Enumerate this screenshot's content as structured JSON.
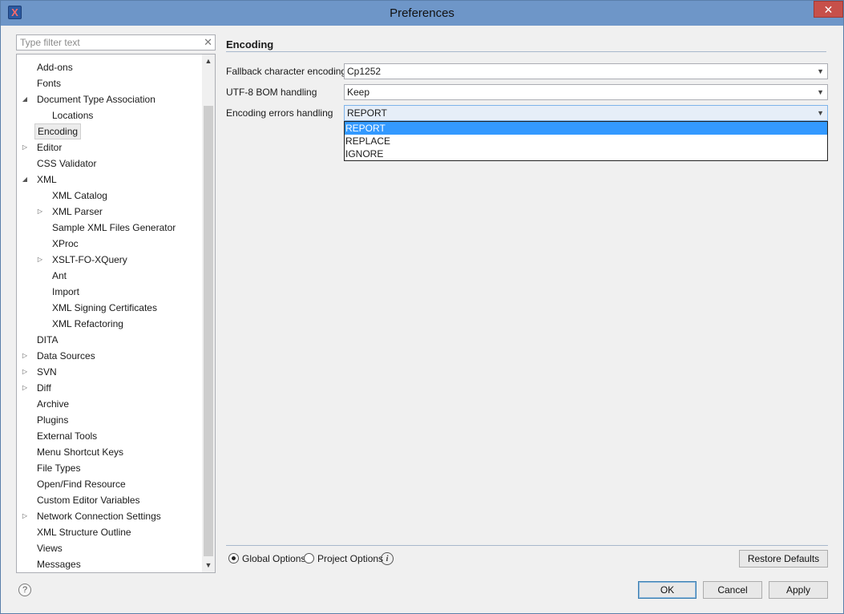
{
  "window": {
    "title": "Preferences",
    "close_glyph": "✕",
    "app_icon_glyph": "X"
  },
  "filter": {
    "placeholder": "Type filter text",
    "clear_glyph": "✕"
  },
  "tree": {
    "items": [
      {
        "label": "Add-ons",
        "level": 1,
        "arrow": ""
      },
      {
        "label": "Fonts",
        "level": 1,
        "arrow": ""
      },
      {
        "label": "Document Type Association",
        "level": 1,
        "arrow": "expanded"
      },
      {
        "label": "Locations",
        "level": 2,
        "arrow": ""
      },
      {
        "label": "Encoding",
        "level": 1,
        "arrow": "",
        "selected": true
      },
      {
        "label": "Editor",
        "level": 1,
        "arrow": "collapsed"
      },
      {
        "label": "CSS Validator",
        "level": 1,
        "arrow": ""
      },
      {
        "label": "XML",
        "level": 1,
        "arrow": "expanded"
      },
      {
        "label": "XML Catalog",
        "level": 2,
        "arrow": ""
      },
      {
        "label": "XML Parser",
        "level": 2,
        "arrow": "collapsed"
      },
      {
        "label": "Sample XML Files Generator",
        "level": 2,
        "arrow": ""
      },
      {
        "label": "XProc",
        "level": 2,
        "arrow": ""
      },
      {
        "label": "XSLT-FO-XQuery",
        "level": 2,
        "arrow": "collapsed"
      },
      {
        "label": "Ant",
        "level": 2,
        "arrow": ""
      },
      {
        "label": "Import",
        "level": 2,
        "arrow": ""
      },
      {
        "label": "XML Signing Certificates",
        "level": 2,
        "arrow": ""
      },
      {
        "label": "XML Refactoring",
        "level": 2,
        "arrow": ""
      },
      {
        "label": "DITA",
        "level": 1,
        "arrow": ""
      },
      {
        "label": "Data Sources",
        "level": 1,
        "arrow": "collapsed"
      },
      {
        "label": "SVN",
        "level": 1,
        "arrow": "collapsed"
      },
      {
        "label": "Diff",
        "level": 1,
        "arrow": "collapsed"
      },
      {
        "label": "Archive",
        "level": 1,
        "arrow": ""
      },
      {
        "label": "Plugins",
        "level": 1,
        "arrow": ""
      },
      {
        "label": "External Tools",
        "level": 1,
        "arrow": ""
      },
      {
        "label": "Menu Shortcut Keys",
        "level": 1,
        "arrow": ""
      },
      {
        "label": "File Types",
        "level": 1,
        "arrow": ""
      },
      {
        "label": "Open/Find Resource",
        "level": 1,
        "arrow": ""
      },
      {
        "label": "Custom Editor Variables",
        "level": 1,
        "arrow": ""
      },
      {
        "label": "Network Connection Settings",
        "level": 1,
        "arrow": "collapsed"
      },
      {
        "label": "XML Structure Outline",
        "level": 1,
        "arrow": ""
      },
      {
        "label": "Views",
        "level": 1,
        "arrow": ""
      },
      {
        "label": "Messages",
        "level": 1,
        "arrow": ""
      }
    ]
  },
  "encoding": {
    "title": "Encoding",
    "fallback_label": "Fallback character encoding",
    "fallback_value": "Cp1252",
    "bom_label": "UTF-8 BOM handling",
    "bom_value": "Keep",
    "errors_label": "Encoding errors handling",
    "errors_value": "REPORT",
    "errors_options": [
      "REPORT",
      "REPLACE",
      "IGNORE"
    ],
    "errors_selected_index": 0
  },
  "options": {
    "global_label": "Global Options",
    "project_label": "Project Options",
    "selected": "global"
  },
  "buttons": {
    "restore_defaults": "Restore Defaults",
    "ok": "OK",
    "cancel": "Cancel",
    "apply": "Apply"
  },
  "help_glyph": "?",
  "info_glyph": "i"
}
